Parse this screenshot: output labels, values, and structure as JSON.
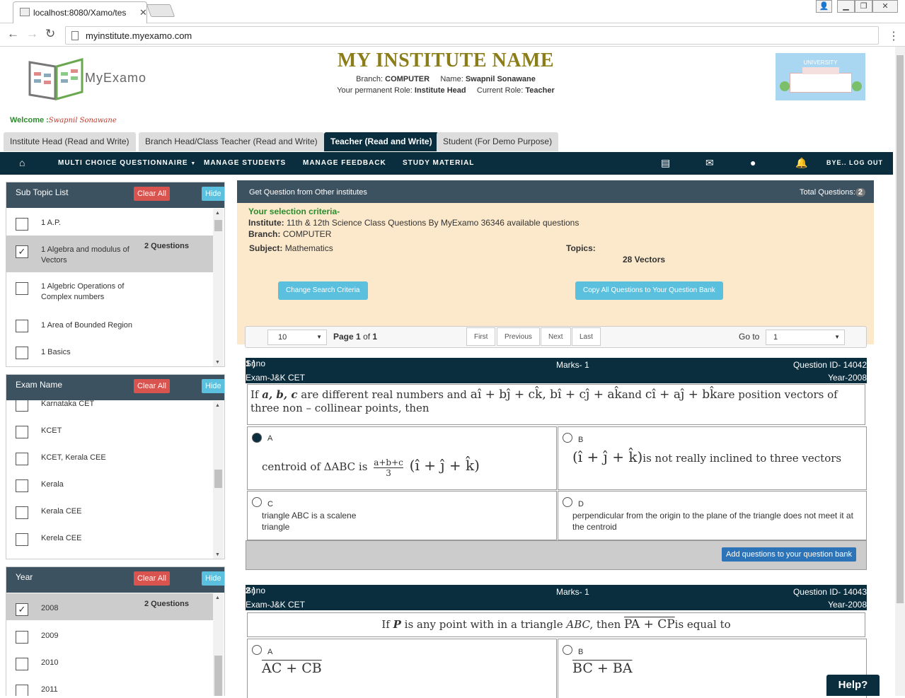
{
  "browser": {
    "tab_title": "localhost:8080/Xamo/tes",
    "url": "myinstitute.myexamo.com"
  },
  "header": {
    "logo_text": "MyExamo",
    "institute_name": "MY INSTITUTE NAME",
    "branch_label": "Branch:",
    "branch": "COMPUTER",
    "name_label": "Name:",
    "name": "Swapnil Sonawane",
    "perm_role_label": "Your permanent Role:",
    "perm_role": "Institute Head",
    "cur_role_label": "Current Role:",
    "cur_role": "Teacher",
    "uni_label": "UNIVERSITY",
    "welcome_label": "Welcome :",
    "welcome_name": "Swapnil Sonawane"
  },
  "role_tabs": [
    "Institute Head (Read and Write)",
    "Branch Head/Class Teacher (Read and Write)",
    "Teacher (Read and Write)",
    "Student (For Demo Purpose)"
  ],
  "nav": {
    "items": [
      "MULTI CHOICE QUESTIONNAIRE",
      "MANAGE STUDENTS",
      "MANAGE FEEDBACK",
      "STUDY MATERIAL"
    ],
    "logout": "BYE.. LOG OUT"
  },
  "panels": {
    "clear_all": "Clear All",
    "hide": "Hide",
    "subtopic": {
      "title": "Sub Topic List",
      "items": [
        {
          "label": "1 A.P.",
          "checked": false,
          "count": ""
        },
        {
          "label": "1 Algebra and modulus of Vectors",
          "checked": true,
          "count": "2 Questions"
        },
        {
          "label": "1 Algebric Operations of Complex numbers",
          "checked": false,
          "count": ""
        },
        {
          "label": "1 Area of Bounded Region",
          "checked": false,
          "count": ""
        },
        {
          "label": "1 Basics",
          "checked": false,
          "count": ""
        }
      ]
    },
    "exam": {
      "title": "Exam Name",
      "items": [
        {
          "label": "Karnataka CET"
        },
        {
          "label": "KCET"
        },
        {
          "label": "KCET, Kerala CEE"
        },
        {
          "label": "Kerala"
        },
        {
          "label": "Kerala CEE"
        },
        {
          "label": "Kerela CEE"
        }
      ]
    },
    "year": {
      "title": "Year",
      "items": [
        {
          "label": "2008",
          "checked": true,
          "count": "2 Questions"
        },
        {
          "label": "2009"
        },
        {
          "label": "2010"
        },
        {
          "label": "2011"
        }
      ]
    }
  },
  "main": {
    "head_title": "Get Question from Other institutes",
    "total_label": "Total Questions:",
    "total": "2",
    "criteria_title": "Your selection criteria-",
    "institute_label": "Institute:",
    "institute": "11th & 12th Science Class Questions By MyExamo 36346 available questions",
    "branch_label": "Branch:",
    "branch": "COMPUTER",
    "subject_label": "Subject:",
    "subject": "Mathematics",
    "topics_label": "Topics:",
    "topic": "28 Vectors",
    "change_btn": "Change Search Criteria",
    "copy_btn": "Copy All Questions to Your Question Bank",
    "pager": {
      "per_page": "10",
      "page_label": "Page",
      "page": "1",
      "of_label": "of",
      "pages": "1",
      "first": "First",
      "previous": "Previous",
      "next": "Next",
      "last": "Last",
      "goto_label": "Go to",
      "goto": "1"
    }
  },
  "questions": [
    {
      "srno_label": "Sr.no",
      "srno": "1 )",
      "marks": "Marks- 1",
      "qid": "Question ID- 14042",
      "exam": "Exam-J&K CET",
      "year": "Year-2008",
      "text_a": "If",
      "text_b": "a, b, c",
      "text_c": "are different real numbers and",
      "math1": "aî + bĵ + ck̂, bî + cĵ + ak̂",
      "text_d": "and",
      "math2": "cî + aĵ + bk̂",
      "text_e": "are position vectors of three non – collinear points, then",
      "opts": [
        {
          "letter": "A",
          "pre": "centroid of ΔABC is",
          "frac_num": "a+b+c",
          "frac_den": "3",
          "post": "(î + ĵ + k̂)",
          "selected": true
        },
        {
          "letter": "B",
          "math": "(î + ĵ + k̂)",
          "text": "is not really inclined to three vectors",
          "selected": false
        },
        {
          "letter": "C",
          "text": "triangle ABC is a scalene triangle",
          "selected": false
        },
        {
          "letter": "D",
          "text": "perpendicular from the origin to the plane of the triangle does not meet it at the centroid",
          "selected": false
        }
      ],
      "add_btn": "Add questions to your question bank"
    },
    {
      "srno_label": "Sr.no",
      "srno": "2 )",
      "marks": "Marks- 1",
      "qid": "Question ID- 14043",
      "exam": "Exam-J&K CET",
      "year": "Year-2008",
      "text_a": "If",
      "text_b": "P",
      "text_c": "is any point with in a triangle",
      "text_b2": "ABC,",
      "text_d": "then",
      "math1": "PA + CP",
      "text_e": "is equal to",
      "opts": [
        {
          "letter": "A",
          "math": "AC + CB"
        },
        {
          "letter": "B",
          "math": "BC + BA"
        }
      ]
    }
  ],
  "help": "Help?"
}
